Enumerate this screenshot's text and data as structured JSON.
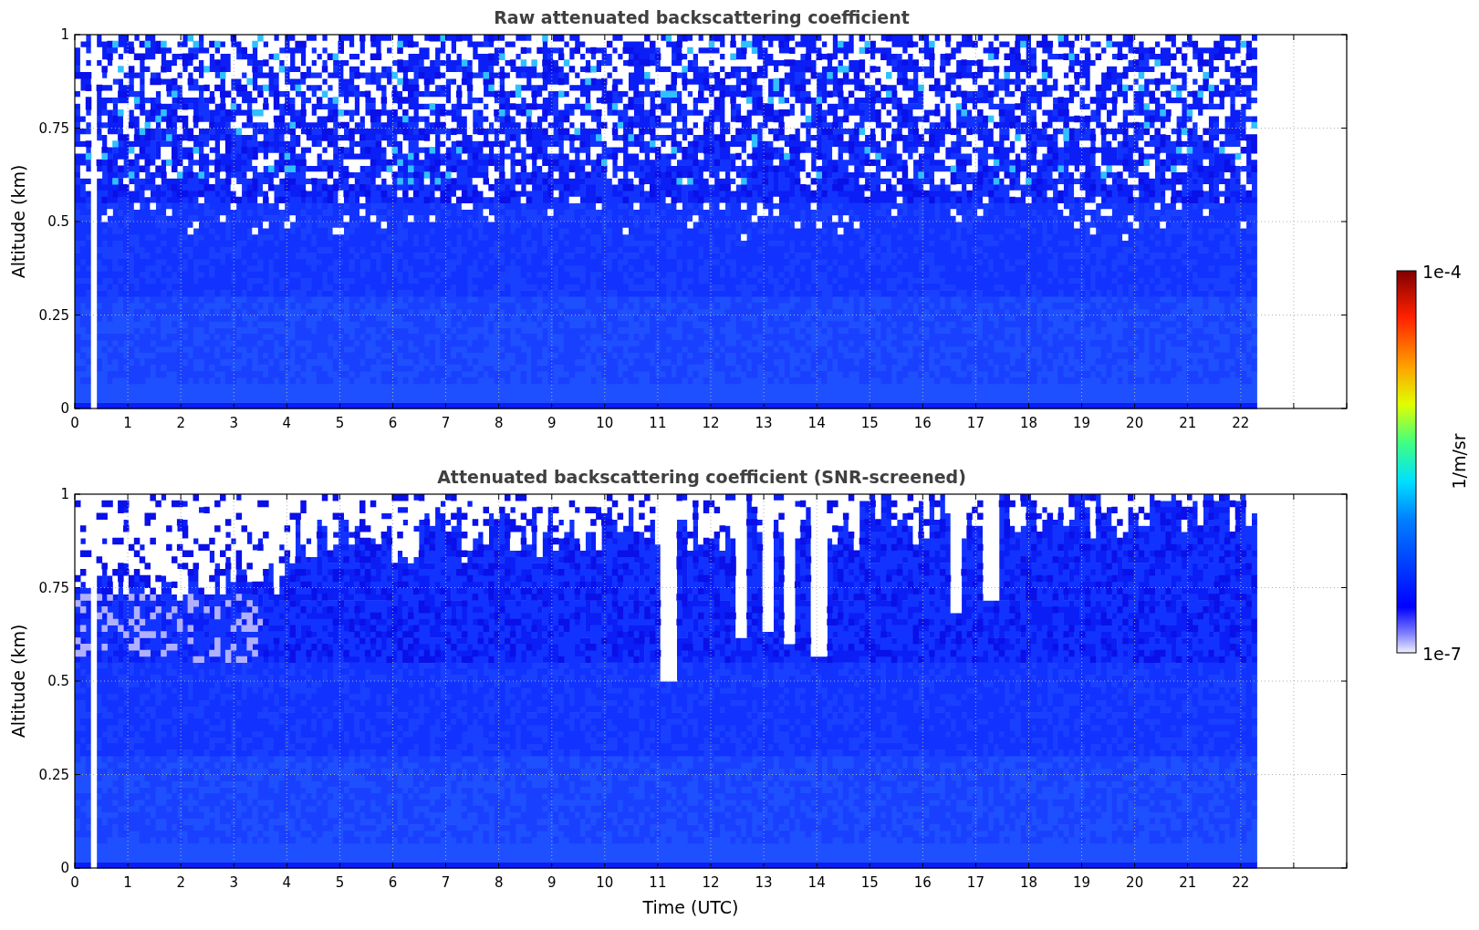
{
  "panels": [
    {
      "kind": "raw",
      "title": "Raw attenuated backscattering coefficient",
      "ylabel": "Altitude (km)",
      "yticks": [
        "1",
        "0.75",
        "0.5",
        "0.25",
        "0"
      ],
      "xticks": [
        "0",
        "1",
        "2",
        "3",
        "4",
        "5",
        "6",
        "7",
        "8",
        "9",
        "10",
        "11",
        "12",
        "13",
        "14",
        "15",
        "16",
        "17",
        "18",
        "19",
        "20",
        "21",
        "22"
      ]
    },
    {
      "kind": "screened",
      "title": "Attenuated backscattering coefficient (SNR-screened)",
      "ylabel": "Altitude (km)",
      "yticks": [
        "1",
        "0.75",
        "0.5",
        "0.25",
        "0"
      ],
      "xticks": [
        "0",
        "1",
        "2",
        "3",
        "4",
        "5",
        "6",
        "7",
        "8",
        "9",
        "10",
        "11",
        "12",
        "13",
        "14",
        "15",
        "16",
        "17",
        "18",
        "19",
        "20",
        "21",
        "22"
      ],
      "xlabel": "Time (UTC)"
    }
  ],
  "colorbar": {
    "label": "1/m/sr",
    "max_label": "1e-4",
    "min_label": "1e-7"
  }
}
